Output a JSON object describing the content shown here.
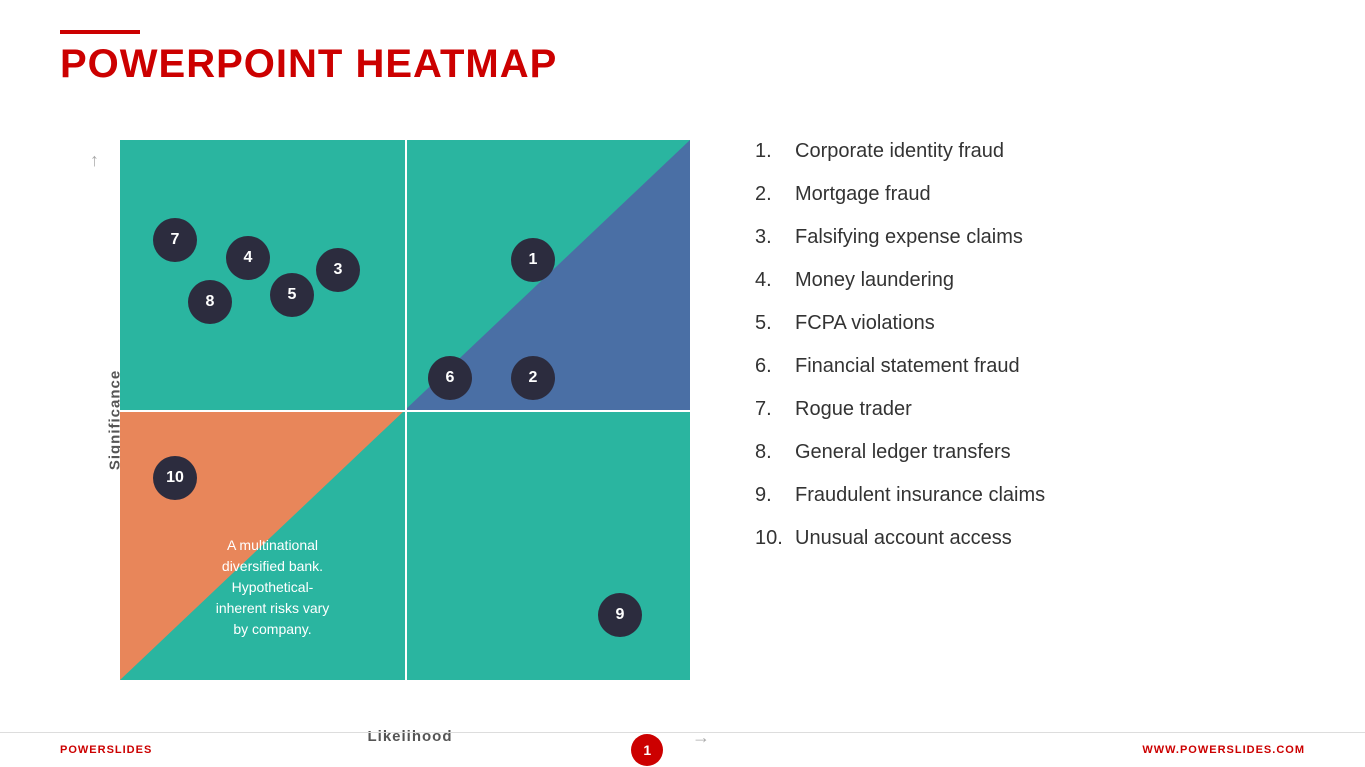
{
  "header": {
    "line_color": "#cc0000",
    "title_plain": "POWERPOINT ",
    "title_accent": "HEATMAP"
  },
  "chart": {
    "axis_x": "Likelihood",
    "axis_y": "Significance",
    "annotation": "A multinational\ndiversified bank.\nHypothetical-\ninherent risks vary\nby company.",
    "colors": {
      "teal": "#2ab5a0",
      "blue": "#4a6fa5",
      "orange": "#e8865a",
      "dark": "#2c2c3e"
    },
    "points": [
      {
        "id": 1,
        "label": "1",
        "x": 72,
        "y": 22
      },
      {
        "id": 2,
        "label": "2",
        "x": 72,
        "y": 44
      },
      {
        "id": 3,
        "label": "3",
        "x": 38,
        "y": 24
      },
      {
        "id": 4,
        "label": "4",
        "x": 22,
        "y": 22
      },
      {
        "id": 5,
        "label": "5",
        "x": 30,
        "y": 28
      },
      {
        "id": 6,
        "label": "6",
        "x": 58,
        "y": 44
      },
      {
        "id": 7,
        "label": "7",
        "x": 10,
        "y": 18
      },
      {
        "id": 8,
        "label": "8",
        "x": 16,
        "y": 30
      },
      {
        "id": 9,
        "label": "9",
        "x": 88,
        "y": 88
      },
      {
        "id": 10,
        "label": "10",
        "x": 8,
        "y": 62
      }
    ]
  },
  "legend": {
    "items": [
      {
        "number": "1.",
        "text": "Corporate identity fraud"
      },
      {
        "number": "2.",
        "text": "Mortgage fraud"
      },
      {
        "number": "3.",
        "text": "Falsifying expense claims"
      },
      {
        "number": "4.",
        "text": "Money laundering"
      },
      {
        "number": "5.",
        "text": "FCPA violations"
      },
      {
        "number": "6.",
        "text": "Financial statement fraud"
      },
      {
        "number": "7.",
        "text": "Rogue trader"
      },
      {
        "number": "8.",
        "text": "General ledger transfers"
      },
      {
        "number": "9.",
        "text": "Fraudulent insurance claims"
      },
      {
        "number": "10.",
        "text": "Unusual account access"
      }
    ]
  },
  "footer": {
    "left_plain": "POWER",
    "left_accent": "SLIDES",
    "page_number": "1",
    "right_plain": "WWW.POWER",
    "right_accent": "SLIDES",
    "right_end": ".COM"
  }
}
